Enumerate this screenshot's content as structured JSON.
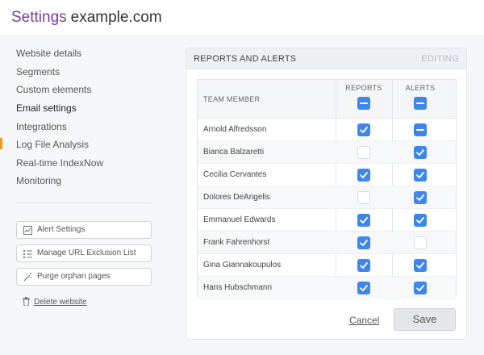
{
  "header": {
    "brand": "Settings",
    "domain": "example.com"
  },
  "sidebar": {
    "items": [
      {
        "label": "Website details",
        "active": false
      },
      {
        "label": "Segments",
        "active": false
      },
      {
        "label": "Custom elements",
        "active": false
      },
      {
        "label": "Email settings",
        "active": true
      },
      {
        "label": "Integrations",
        "active": false
      },
      {
        "label": "Log File Analysis",
        "active": false
      },
      {
        "label": "Real-time IndexNow",
        "active": false
      },
      {
        "label": "Monitoring",
        "active": false
      }
    ],
    "active_marker_color": "#f39c12",
    "buttons": [
      {
        "label": "Alert Settings",
        "icon": "chart-icon"
      },
      {
        "label": "Manage URL Exclusion List",
        "icon": "list-icon"
      },
      {
        "label": "Purge orphan pages",
        "icon": "wand-icon"
      }
    ],
    "delete_label": "Delete website",
    "delete_icon": "trash-icon"
  },
  "panel": {
    "title": "REPORTS AND ALERTS",
    "status": "EDITING",
    "table": {
      "col_member": "TEAM MEMBER",
      "col_reports": "REPORTS",
      "col_alerts": "ALERTS",
      "header_reports_state": "indeterminate",
      "header_alerts_state": "indeterminate",
      "rows": [
        {
          "name": "Arnold Alfredsson",
          "reports": "checked",
          "alerts": "indeterminate"
        },
        {
          "name": "Bianca Balzaretti",
          "reports": "unchecked",
          "alerts": "checked"
        },
        {
          "name": "Cecilia Cervantes",
          "reports": "checked",
          "alerts": "checked"
        },
        {
          "name": "Dolores DeAngelis",
          "reports": "unchecked",
          "alerts": "checked"
        },
        {
          "name": "Emmanuel Edwards",
          "reports": "checked",
          "alerts": "checked"
        },
        {
          "name": "Frank Fahrenhorst",
          "reports": "checked",
          "alerts": "unchecked"
        },
        {
          "name": "Gina Giannakoupulos",
          "reports": "checked",
          "alerts": "checked"
        },
        {
          "name": "Hans Hubschmann",
          "reports": "checked",
          "alerts": "checked"
        }
      ]
    },
    "cancel_label": "Cancel",
    "save_label": "Save"
  },
  "colors": {
    "brand": "#7b3a9d",
    "checkbox": "#3f86ea",
    "accent": "#f39c12"
  }
}
